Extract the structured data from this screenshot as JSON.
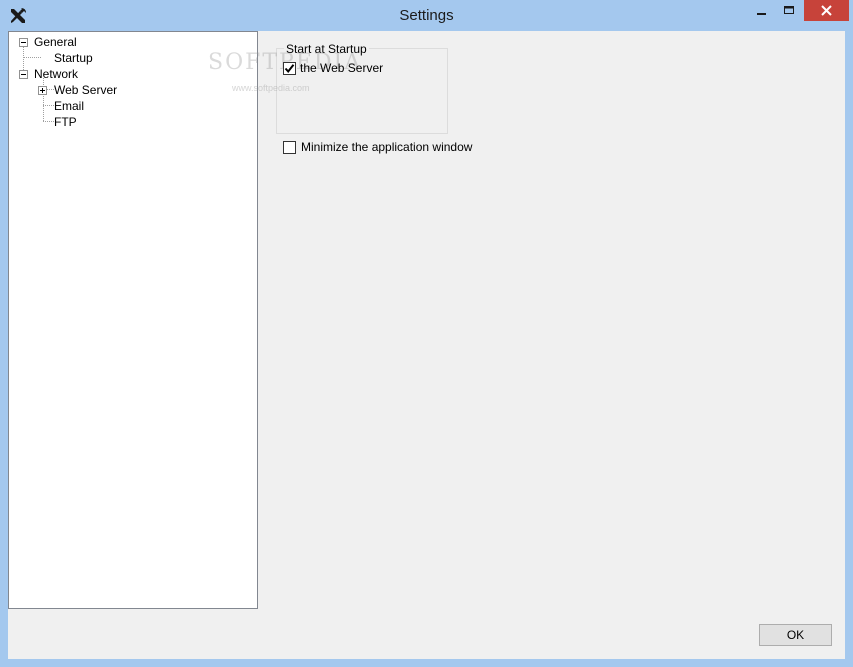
{
  "window": {
    "title": "Settings"
  },
  "titlebar": {
    "icons": {
      "app": "tools-icon",
      "minimize": "minimize-icon",
      "maximize": "maximize-icon",
      "close": "close-icon"
    },
    "close_color": "#c7433a"
  },
  "tree": {
    "general": {
      "label": "General",
      "expanded": true
    },
    "startup": {
      "label": "Startup"
    },
    "network": {
      "label": "Network",
      "expanded": true
    },
    "web_server": {
      "label": "Web Server",
      "expanded": false
    },
    "email": {
      "label": "Email"
    },
    "ftp": {
      "label": "FTP"
    }
  },
  "content": {
    "group": {
      "label": "Start at Startup",
      "web_server": {
        "label": "the Web Server",
        "checked": true
      }
    },
    "minimize": {
      "label": "Minimize the application window",
      "checked": false
    }
  },
  "watermark": {
    "text": "SOFTPEDIA",
    "url": "www.softpedia.com"
  },
  "footer": {
    "ok_label": "OK"
  }
}
